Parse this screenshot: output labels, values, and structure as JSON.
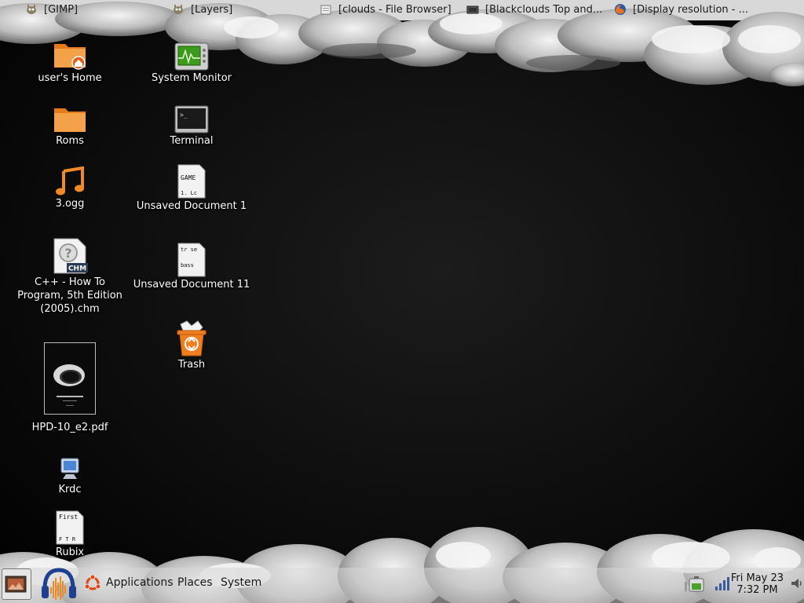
{
  "top_panel": {
    "tasks": [
      {
        "label": "[GIMP]",
        "icon": "gimp-icon"
      },
      {
        "label": "[Layers]",
        "icon": "gimp-icon"
      },
      {
        "label": "[clouds - File Browser]",
        "icon": "file-browser-icon"
      },
      {
        "label": "[Blackclouds Top and...",
        "icon": "image-viewer-icon"
      },
      {
        "label": "[Display resolution - ...",
        "icon": "firefox-icon"
      }
    ]
  },
  "desktop_icons": {
    "col1": [
      {
        "label": "user's Home",
        "icon": "home-folder-icon"
      },
      {
        "label": "Roms",
        "icon": "folder-icon"
      },
      {
        "label": "3.ogg",
        "icon": "music-note-icon"
      },
      {
        "label": "C++ - How To Program, 5th Edition (2005).chm",
        "icon": "chm-help-icon",
        "badge": "CHM"
      },
      {
        "label": "HPD-10_e2.pdf",
        "icon": "pdf-thumbnail-icon"
      },
      {
        "label": "Krdc",
        "icon": "remote-desktop-icon"
      },
      {
        "label": "Rubix",
        "icon": "text-document-icon",
        "preview": [
          "First",
          "F T R"
        ]
      }
    ],
    "col2": [
      {
        "label": "System Monitor",
        "icon": "system-monitor-icon"
      },
      {
        "label": "Terminal",
        "icon": "terminal-icon"
      },
      {
        "label": "Unsaved Document 1",
        "icon": "text-document-icon",
        "preview": [
          "GAME",
          "1. Lc"
        ]
      },
      {
        "label": "Unsaved Document 11",
        "icon": "text-document-icon",
        "preview": [
          "tr se",
          "bass"
        ]
      },
      {
        "label": "Trash",
        "icon": "trash-icon"
      }
    ]
  },
  "bottom_panel": {
    "launchers": [
      {
        "icon": "show-desktop-icon"
      },
      {
        "icon": "audacity-icon"
      }
    ],
    "menus": [
      "Applications",
      "Places",
      "System"
    ],
    "tray": [
      "battery-icon",
      "network-signal-icon",
      "volume-icon"
    ],
    "clock": {
      "date": "Fri May 23",
      "time": "7:32 PM"
    }
  },
  "colors": {
    "folder": "#f08a24",
    "trash": "#f07d1e",
    "monitor_green": "#3c9a1c"
  }
}
